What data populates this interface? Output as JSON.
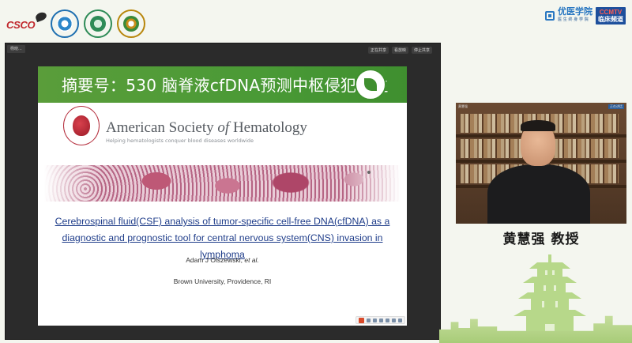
{
  "header": {
    "csco_logo": "CSCO",
    "brand_name": "优医学院",
    "brand_sub": "医 生 终 身 学 院",
    "ccmtv_top": "CCMTV",
    "ccmtv_bottom": "临床频道"
  },
  "share_window": {
    "window_label": "杨晓...",
    "tabs": [
      "正在共享",
      "看放映",
      "停止共享"
    ]
  },
  "slide": {
    "title": "摘要号：530  脑脊液cfDNA预测中枢侵犯发生",
    "badge_caption": "",
    "org_name_plain": "American Society ",
    "org_name_italic": "of",
    "org_name_end": " Hematology",
    "org_tagline": "Helping hematologists conquer blood diseases worldwide",
    "paper_title_line1": "Cerebrospinal fluid(CSF) analysis of tumor-specific cell-free DNA(cfDNA) as a",
    "paper_title_line2": "diagnostic and prognostic tool for central nervous system(CNS) invasion in lymphoma",
    "author": "Adam J Olszewski, ",
    "author_etal": "et al.",
    "affiliation": "Brown University, Providence, RI"
  },
  "speaker": {
    "name": "黄慧强 教授",
    "video_label_left": "黄慧强",
    "video_label_right": "正在讲话"
  },
  "colors": {
    "slide_header_green": "#4a9a36",
    "paper_title_blue": "#1f3d8a",
    "brand_blue": "#2a78c2",
    "ccmtv_navy": "#1d4f9c"
  }
}
